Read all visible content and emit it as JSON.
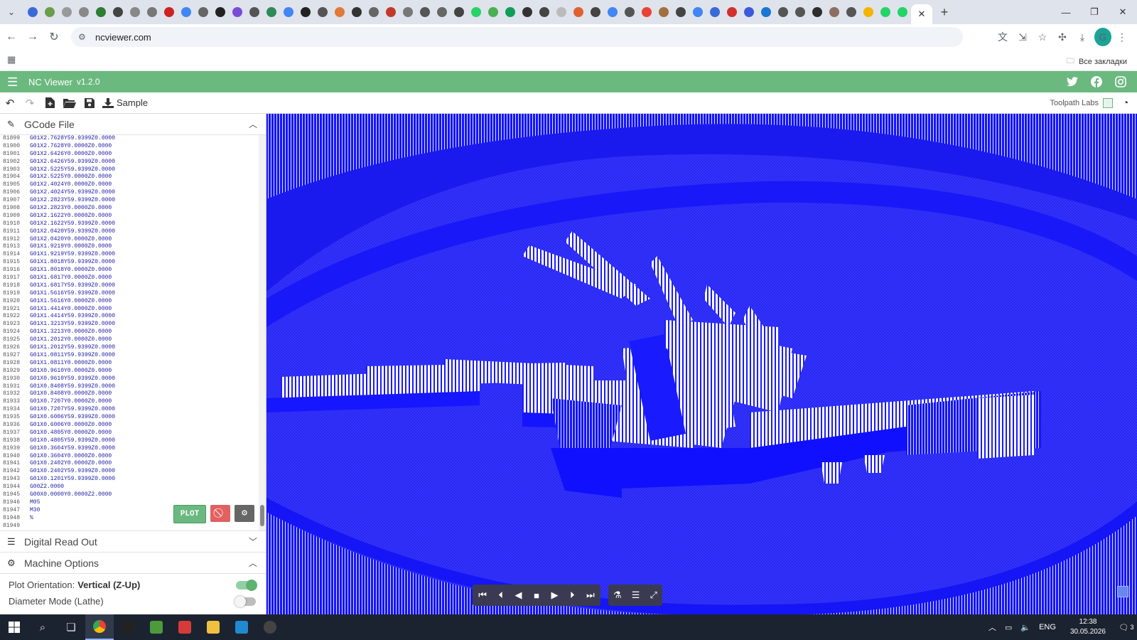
{
  "browser": {
    "url": "ncviewer.com",
    "bookmarks_label": "Все закладки",
    "active_tab_close": "✕",
    "new_tab": "+",
    "favicon_colors": [
      "#3b6ad8",
      "#6a9e4b",
      "#999999",
      "#888888",
      "#2e7d32",
      "#444444",
      "#888888",
      "#777777",
      "#cc2222",
      "#4285f4",
      "#666666",
      "#222222",
      "#7b4bd8",
      "#555555",
      "#2e8b57",
      "#4285f4",
      "#222222",
      "#555555",
      "#e07a3a",
      "#333333",
      "#666666",
      "#c0392b",
      "#777777",
      "#555555",
      "#666666",
      "#444444",
      "#25d366",
      "#4caf50",
      "#0f9d58",
      "#333333",
      "#444444",
      "#bbbbbb",
      "#e06030",
      "#444444",
      "#4285f4",
      "#555555",
      "#ea4335",
      "#a07040",
      "#444444",
      "#4285f4",
      "#3a6ad8",
      "#d32f2f",
      "#3b5bdb",
      "#1976d2",
      "#555555",
      "#555555",
      "#2e2e2e",
      "#8d6e63",
      "#555555",
      "#f4b400",
      "#25d366",
      "#25d366"
    ]
  },
  "app": {
    "title": "NC Viewer",
    "version": "v1.2.0",
    "sample_label": "Sample",
    "toolpath_label": "Toolpath Labs",
    "accent": "#6bb97f"
  },
  "gcode": {
    "header": "GCode File",
    "lines": [
      {
        "n": "81899",
        "t": "G01X2.7628Y59.9399Z0.0000"
      },
      {
        "n": "81900",
        "t": "G01X2.7628Y0.0000Z0.0000"
      },
      {
        "n": "81901",
        "t": "G01X2.6426Y0.0000Z0.0000"
      },
      {
        "n": "81902",
        "t": "G01X2.6426Y59.9399Z0.0000"
      },
      {
        "n": "81903",
        "t": "G01X2.5225Y59.9399Z0.0000"
      },
      {
        "n": "81904",
        "t": "G01X2.5225Y0.0000Z0.0000"
      },
      {
        "n": "81905",
        "t": "G01X2.4024Y0.0000Z0.0000"
      },
      {
        "n": "81906",
        "t": "G01X2.4024Y59.9399Z0.0000"
      },
      {
        "n": "81907",
        "t": "G01X2.2823Y59.9399Z0.0000"
      },
      {
        "n": "81908",
        "t": "G01X2.2823Y0.0000Z0.0000"
      },
      {
        "n": "81909",
        "t": "G01X2.1622Y0.0000Z0.0000"
      },
      {
        "n": "81910",
        "t": "G01X2.1622Y59.9399Z0.0000"
      },
      {
        "n": "81911",
        "t": "G01X2.0420Y59.9399Z0.0000"
      },
      {
        "n": "81912",
        "t": "G01X2.0420Y0.0000Z0.0000"
      },
      {
        "n": "81913",
        "t": "G01X1.9219Y0.0000Z0.0000"
      },
      {
        "n": "81914",
        "t": "G01X1.9219Y59.9399Z0.0000"
      },
      {
        "n": "81915",
        "t": "G01X1.8018Y59.9399Z0.0000"
      },
      {
        "n": "81916",
        "t": "G01X1.8018Y0.0000Z0.0000"
      },
      {
        "n": "81917",
        "t": "G01X1.6817Y0.0000Z0.0000"
      },
      {
        "n": "81918",
        "t": "G01X1.6817Y59.9399Z0.0000"
      },
      {
        "n": "81919",
        "t": "G01X1.5616Y59.9399Z0.0000"
      },
      {
        "n": "81920",
        "t": "G01X1.5616Y0.0000Z0.0000"
      },
      {
        "n": "81921",
        "t": "G01X1.4414Y0.0000Z0.0000"
      },
      {
        "n": "81922",
        "t": "G01X1.4414Y59.9399Z0.0000"
      },
      {
        "n": "81923",
        "t": "G01X1.3213Y59.9399Z0.0000"
      },
      {
        "n": "81924",
        "t": "G01X1.3213Y0.0000Z0.0000"
      },
      {
        "n": "81925",
        "t": "G01X1.2012Y0.0000Z0.0000"
      },
      {
        "n": "81926",
        "t": "G01X1.2012Y59.9399Z0.0000"
      },
      {
        "n": "81927",
        "t": "G01X1.0811Y59.9399Z0.0000"
      },
      {
        "n": "81928",
        "t": "G01X1.0811Y0.0000Z0.0000"
      },
      {
        "n": "81929",
        "t": "G01X0.9610Y0.0000Z0.0000"
      },
      {
        "n": "81930",
        "t": "G01X0.9610Y59.9399Z0.0000"
      },
      {
        "n": "81931",
        "t": "G01X0.8408Y59.9399Z0.0000"
      },
      {
        "n": "81932",
        "t": "G01X0.8408Y0.0000Z0.0000"
      },
      {
        "n": "81933",
        "t": "G01X0.7207Y0.0000Z0.0000"
      },
      {
        "n": "81934",
        "t": "G01X0.7207Y59.9399Z0.0000"
      },
      {
        "n": "81935",
        "t": "G01X0.6006Y59.9399Z0.0000"
      },
      {
        "n": "81936",
        "t": "G01X0.6006Y0.0000Z0.0000"
      },
      {
        "n": "81937",
        "t": "G01X0.4805Y0.0000Z0.0000"
      },
      {
        "n": "81938",
        "t": "G01X0.4805Y59.9399Z0.0000"
      },
      {
        "n": "81939",
        "t": "G01X0.3604Y59.9399Z0.0000"
      },
      {
        "n": "81940",
        "t": "G01X0.3604Y0.0000Z0.0000"
      },
      {
        "n": "81941",
        "t": "G01X0.2402Y0.0000Z0.0000"
      },
      {
        "n": "81942",
        "t": "G01X0.2402Y59.9399Z0.0000"
      },
      {
        "n": "81943",
        "t": "G01X0.1201Y59.9399Z0.0000"
      },
      {
        "n": "81944",
        "t": "G00Z2.0000"
      },
      {
        "n": "81945",
        "t": "G00X0.0000Y0.0000Z2.0000"
      },
      {
        "n": "81946",
        "t": "M05"
      },
      {
        "n": "81947",
        "t": "M30"
      },
      {
        "n": "81948",
        "t": "%"
      },
      {
        "n": "81949",
        "t": ""
      }
    ],
    "plot_label": "PLOT"
  },
  "panels": {
    "dro_label": "Digital Read Out",
    "machine_options_label": "Machine Options",
    "options": [
      {
        "label": "Plot Orientation:",
        "value": "Vertical (Z-Up)",
        "on": true
      },
      {
        "label": "Diameter Mode (Lathe)",
        "value": "",
        "on": false
      }
    ]
  },
  "viewport": {
    "toolpath_color": "#1010ff",
    "background_color": "#2c2cf0",
    "white": "#ffffff"
  },
  "taskbar": {
    "time": "12:38",
    "date": "30.05.2026",
    "lang": "ENG",
    "notifications": "3"
  }
}
